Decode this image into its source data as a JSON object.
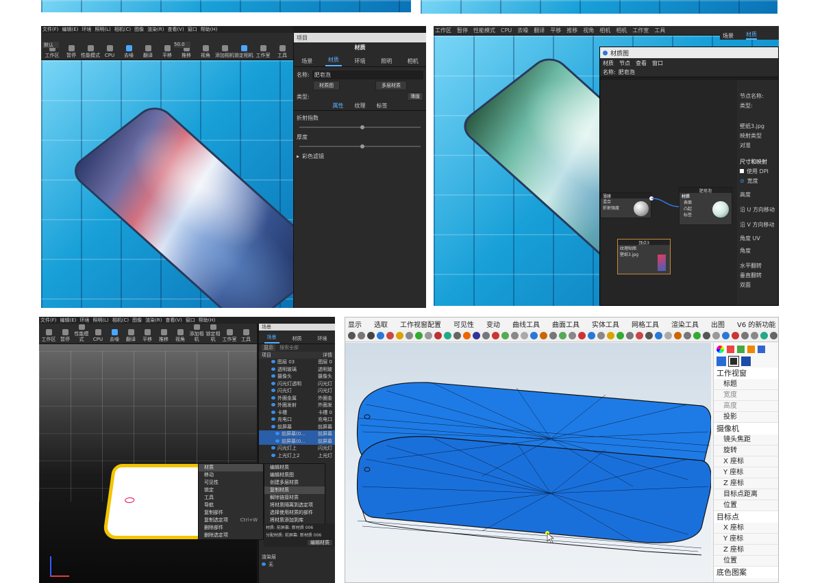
{
  "top_strip": {},
  "panel1": {
    "menu": [
      "文件(F)",
      "编辑(E)",
      "环境",
      "照明(L)",
      "相机(C)",
      "图像",
      "渲染(R)",
      "查看(V)",
      "窗口",
      "帮助(H)"
    ],
    "scene_name": "默认",
    "toolbar": [
      "工作区",
      "暂停",
      "性能模式",
      "CPU",
      "去噪",
      "翻译",
      "平移",
      "推移",
      "视角",
      "添加相机",
      "锁定相机",
      "工作室",
      "工具"
    ],
    "resolution": "50.0",
    "side_header": "项目",
    "panel_title": "材质",
    "tabs": [
      "场景",
      "材质",
      "环境",
      "照明",
      "相机"
    ],
    "name_label": "名称:",
    "name_value": "肥皂泡",
    "btn_material_graph": "材质图",
    "btn_multilayer": "多层材质",
    "type_label": "类型:",
    "type_value": "薄膜",
    "subtabs": [
      "属性",
      "纹理",
      "标签"
    ],
    "props": [
      "折射指数",
      "厚度"
    ],
    "color_filter": "彩色滤镜"
  },
  "panel2": {
    "menu": [
      "工作区",
      "暂停",
      "性能模式",
      "CPU",
      "去噪",
      "翻译",
      "平移",
      "推移",
      "视角",
      "相机",
      "相机",
      "工作室",
      "工具"
    ],
    "tabs": [
      "场景",
      "材质"
    ],
    "window_title": "材质图",
    "wmenu": [
      "材质",
      "节点",
      "查看",
      "窗口"
    ],
    "name_label": "名称:",
    "name_value": "肥皂泡",
    "node_film": {
      "title": "薄膜",
      "ports": [
        "混合",
        "折射强度"
      ]
    },
    "node_material": {
      "header": "肥皂泡",
      "title": "材质",
      "ports": [
        "表面",
        "凸起",
        "标签"
      ]
    },
    "node_texture": {
      "header": "顶点3",
      "title": "纹理贴图",
      "file": "壁纸3.jpg"
    },
    "props": {
      "node_name": "节点名称:",
      "type": "类型:",
      "file": "壁纸3.jpg",
      "mapping": "映射类型",
      "align": "对准",
      "size_section": "尺寸和映射",
      "use_dpi": "使用 DPI",
      "width": "宽度",
      "height": "高度",
      "u_move": "沿 U 方向移动",
      "v_move": "沿 V 方向移动",
      "angle_uv": "角度 UV",
      "angle": "角度",
      "flip_h": "水平翻转",
      "flip_v": "垂直翻转",
      "double": "双面"
    }
  },
  "panel3": {
    "menu": [
      "文件(F)",
      "编辑(E)",
      "环境",
      "照明(L)",
      "相机(C)",
      "图像",
      "渲染(R)",
      "查看(V)",
      "窗口",
      "帮助(H)"
    ],
    "toolbar": [
      "工作区",
      "暂停",
      "性能模式",
      "CPU",
      "去噪",
      "翻译",
      "平移",
      "推移",
      "视角",
      "添加相机",
      "锁定相机",
      "工作室",
      "工具"
    ],
    "tabs": [
      "场景",
      "材质",
      "环境"
    ],
    "side_header": "场景",
    "show": "显示",
    "search": "搜索全部",
    "cols": [
      "项目",
      "详情"
    ],
    "tree": [
      [
        "图层 03",
        "图层 0"
      ],
      [
        "透明玻璃",
        "透明玻"
      ],
      [
        "摄像头",
        "摄像头"
      ],
      [
        "闪光灯透明",
        "闪光灯"
      ],
      [
        "闪光灯",
        "闪光灯"
      ],
      [
        "外圈金属",
        "外圈金"
      ],
      [
        "外圈发射",
        "外圈发"
      ],
      [
        "卡槽",
        "卡槽 0"
      ],
      [
        "充电口",
        "充电口"
      ],
      [
        "前屏幕",
        "前屏幕"
      ],
      [
        "前屏幕(0...",
        "前屏幕"
      ],
      [
        "前屏幕(0...",
        "前屏幕"
      ],
      [
        "闪光灯上",
        "闪光灯"
      ],
      [
        "上光灯上2",
        "上光灯"
      ]
    ],
    "context_menu": [
      "材质",
      "移动",
      "可见性",
      "锁定",
      "工具",
      "导航",
      "复制部件",
      "复制选定项",
      "删除部件",
      "删除选定项"
    ],
    "shortcut": "Ctrl+W",
    "submenu": [
      "编辑材质",
      "编辑材质图",
      "创建多层材质",
      "复制材质",
      "解除链接材质",
      "将材质隔离到选定项",
      "选择使用材质的部件",
      "将材质添加到库"
    ],
    "info1": "材质: 前屏幕: 新材质 006",
    "info2": "分配材质: 前屏幕: 新材质 006",
    "edit_btn": "编辑材质",
    "render_layer": "渲染层",
    "render_none": "无"
  },
  "panel4": {
    "menu": [
      "显示",
      "选取",
      "工作视窗配置",
      "可见性",
      "变动",
      "曲线工具",
      "曲面工具",
      "实体工具",
      "网格工具",
      "渲染工具",
      "出图",
      "V6 的新功能"
    ],
    "props": [
      {
        "t": "工作视窗",
        "hd": true
      },
      {
        "t": "标题"
      },
      {
        "t": "宽度",
        "dis": true
      },
      {
        "t": "高度",
        "dis": true
      },
      {
        "t": "投影"
      },
      {
        "t": "摄像机",
        "hd": true
      },
      {
        "t": "镜头焦距"
      },
      {
        "t": "旋转"
      },
      {
        "t": "X 座标"
      },
      {
        "t": "Y 座标"
      },
      {
        "t": "Z 座标"
      },
      {
        "t": "目标点距离"
      },
      {
        "t": "位置"
      },
      {
        "t": "目标点",
        "hd": true
      },
      {
        "t": "X 座标"
      },
      {
        "t": "Y 座标"
      },
      {
        "t": "Z 座标"
      },
      {
        "t": "位置"
      },
      {
        "t": "底色图案",
        "hd": true
      }
    ]
  }
}
